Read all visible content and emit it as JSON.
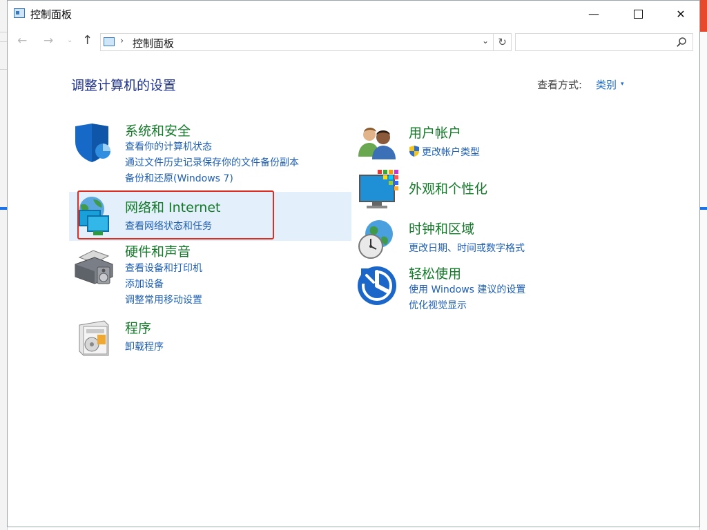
{
  "window": {
    "title": "控制面板",
    "minimize_glyph": "—",
    "close_glyph": "✕"
  },
  "nav": {
    "back_glyph": "←",
    "forward_glyph": "→",
    "dropdown_glyph": "⌄",
    "up_glyph": "↑",
    "breadcrumb_sep": "›",
    "address_text": "控制面板",
    "address_dropdown_glyph": "⌄",
    "refresh_glyph": "↻",
    "search_placeholder": ""
  },
  "main": {
    "heading": "调整计算机的设置",
    "view_by_label": "查看方式:",
    "view_by_value": "类别",
    "view_by_caret": "▾"
  },
  "categories": [
    {
      "title": "系统和安全",
      "icon": "shield-icon",
      "links": [
        "查看你的计算机状态",
        "通过文件历史记录保存你的文件备份副本",
        "备份和还原(Windows 7)"
      ]
    },
    {
      "title": "网络和 Internet",
      "icon": "network-icon",
      "links": [
        "查看网络状态和任务"
      ]
    },
    {
      "title": "硬件和声音",
      "icon": "printer-icon",
      "links": [
        "查看设备和打印机",
        "添加设备",
        "调整常用移动设置"
      ]
    },
    {
      "title": "程序",
      "icon": "programs-icon",
      "links": [
        "卸载程序"
      ]
    },
    {
      "title": "用户帐户",
      "icon": "users-icon",
      "links": [
        "更改帐户类型"
      ]
    },
    {
      "title": "外观和个性化",
      "icon": "appearance-icon",
      "links": []
    },
    {
      "title": "时钟和区域",
      "icon": "clock-globe-icon",
      "links": [
        "更改日期、时间或数字格式"
      ]
    },
    {
      "title": "轻松使用",
      "icon": "ease-of-access-icon",
      "links": [
        "使用 Windows 建议的设置",
        "优化视觉显示"
      ]
    }
  ],
  "colors": {
    "heading": "#1e3287",
    "category_title": "#147a2a",
    "link": "#1e5fb4",
    "highlight_row": "#e3effa",
    "annotation_box": "#e02b1f"
  }
}
